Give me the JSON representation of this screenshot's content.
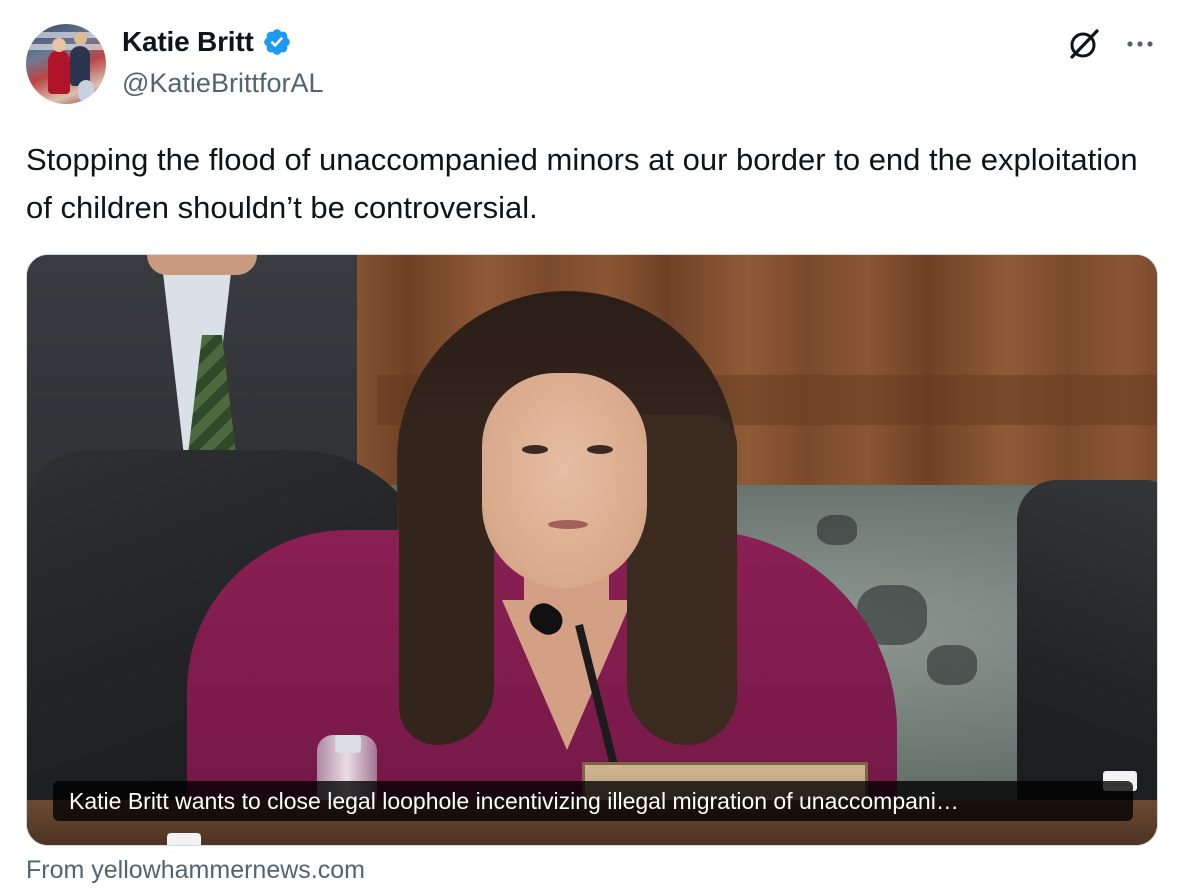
{
  "author": {
    "display_name": "Katie Britt",
    "handle": "@KatieBrittforAL",
    "verified": true,
    "verified_color": "#1d9bf0"
  },
  "header_icons": {
    "grok": "grok-icon",
    "more": "more-options-icon"
  },
  "tweet": {
    "text": "Stopping the flood of unaccompanied minors at our border to end the exploitation of children shouldn’t be controversial."
  },
  "media": {
    "caption": "Katie Britt wants to close legal loophole incentivizing illegal migration of unaccompani…",
    "source": "From yellowhammernews.com"
  },
  "colors": {
    "text_primary": "#0f1419",
    "text_secondary": "#536471",
    "border": "#cfd9de"
  }
}
